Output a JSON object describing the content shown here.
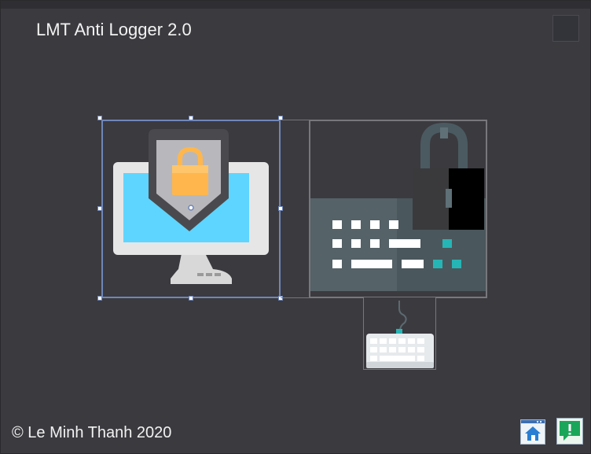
{
  "window": {
    "title": "LMT Anti Logger 2.0",
    "footer": "© Le Minh Thanh 2020"
  },
  "icons": {
    "corner": "square-button-icon",
    "monitor_lock": "monitor-shield-lock-icon",
    "keyboard_lock": "keyboard-padlock-icon",
    "small_keyboard": "keyboard-icon",
    "home": "home-icon",
    "feedback": "feedback-alert-icon"
  },
  "colors": {
    "background": "#3b3a3f",
    "selection": "#6f86b8",
    "screen": "#5ed5ff",
    "lock": "#ffb74d",
    "keyboard_body": "#4f5d63",
    "accent_teal": "#26b5b5"
  }
}
